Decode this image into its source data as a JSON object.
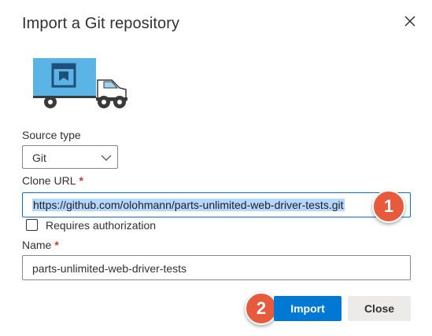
{
  "dialog": {
    "title": "Import a Git repository",
    "close_icon": "close-icon",
    "illustration_icon": "moving-truck-repository-icon"
  },
  "form": {
    "source_type": {
      "label": "Source type",
      "selected": "Git",
      "icon": "chevron-down-icon"
    },
    "clone_url": {
      "label": "Clone URL",
      "required_marker": "*",
      "value": "https://github.com/olohmann/parts-unlimited-web-driver-tests.git"
    },
    "requires_auth": {
      "label": "Requires authorization",
      "checked": false
    },
    "name": {
      "label": "Name",
      "required_marker": "*",
      "value": "parts-unlimited-web-driver-tests"
    }
  },
  "annotations": {
    "step1": "1",
    "step2": "2"
  },
  "buttons": {
    "import_label": "Import",
    "close_label": "Close"
  },
  "colors": {
    "accent": "#0078d4",
    "required": "#d13438",
    "badge": "#e85a3c",
    "truck_body": "#5ab4e5"
  }
}
